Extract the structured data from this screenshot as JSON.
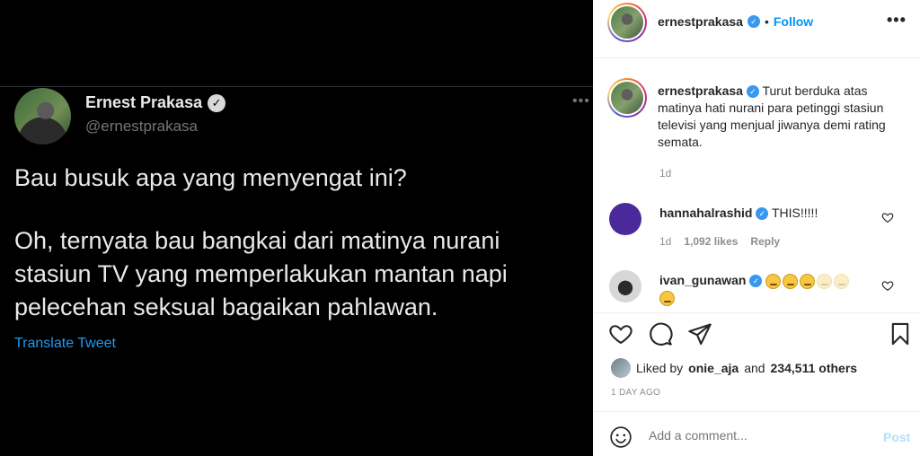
{
  "tweet": {
    "display_name": "Ernest Prakasa",
    "handle": "@ernestprakasa",
    "paragraph_1": "Bau busuk apa yang menyengat ini?",
    "paragraph_2": "Oh, ternyata bau bangkai dari matinya nurani stasiun TV yang memperlakukan mantan napi pelecehan seksual bagaikan pahlawan.",
    "translate_label": "Translate Tweet"
  },
  "post_header": {
    "username": "ernestprakasa",
    "separator": "•",
    "follow_label": "Follow",
    "more_label": "•••"
  },
  "caption": {
    "username": "ernestprakasa",
    "text": "Turut berduka atas matinya hati nurani para petinggi stasiun televisi yang menjual jiwanya demi rating semata.",
    "time": "1d"
  },
  "comments": [
    {
      "username": "hannahalrashid",
      "text": "THIS!!!!!",
      "time": "1d",
      "likes": "1,092 likes",
      "reply_label": "Reply"
    },
    {
      "username": "ivan_gunawan",
      "emoji_names": [
        "sad-face",
        "sad-face",
        "sad-face",
        "sad-face",
        "sad-face",
        "sad-face"
      ]
    }
  ],
  "likes": {
    "prefix": "Liked by",
    "user": "onie_aja",
    "middle": "and",
    "others": "234,511 others"
  },
  "post_date": "1 DAY AGO",
  "add_comment": {
    "placeholder": "Add a comment...",
    "post_label": "Post"
  },
  "colors": {
    "link_blue": "#0095f6",
    "twitter_blue": "#1d9bf0",
    "comment_avatar_purple": "#4a2a9a"
  }
}
